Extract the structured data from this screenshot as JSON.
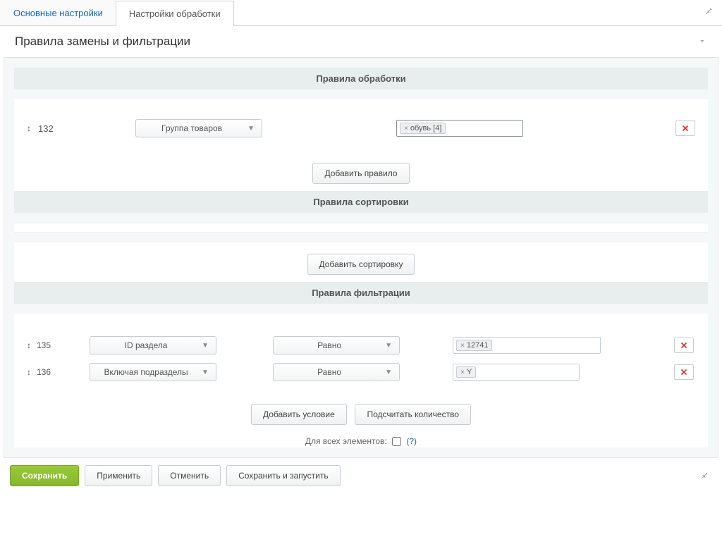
{
  "tabs": {
    "basic": "Основные настройки",
    "processing": "Настройки обработки"
  },
  "panel": {
    "title": "Правила замены и фильтрации"
  },
  "sections": {
    "processing_title": "Правила обработки",
    "sorting_title": "Правила сортировки",
    "filtering_title": "Правила фильтрации"
  },
  "rules": {
    "processing": [
      {
        "id": "132",
        "field": "Группа товаров",
        "tag": "обувь [4]"
      }
    ]
  },
  "buttons": {
    "add_rule": "Добавить правило",
    "add_sort": "Добавить сортировку",
    "add_condition": "Добавить условие",
    "count": "Подсчитать количество",
    "save": "Сохранить",
    "apply": "Применить",
    "cancel": "Отменить",
    "save_run": "Сохранить и запустить"
  },
  "filters": [
    {
      "id": "135",
      "field": "ID раздела",
      "op": "Равно",
      "value": "12741"
    },
    {
      "id": "136",
      "field": "Включая подразделы",
      "op": "Равно",
      "value": "Y"
    }
  ],
  "check": {
    "label": "Для всех элементов:",
    "help": "(?)"
  }
}
